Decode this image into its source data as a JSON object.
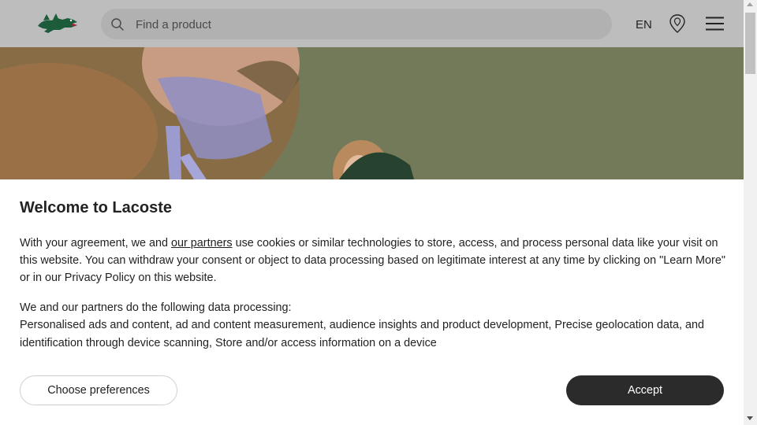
{
  "header": {
    "logo_icon": "crocodile-logo-icon",
    "search": {
      "placeholder": "Find a product",
      "icon": "search-icon"
    },
    "language": "EN",
    "store_locator_icon": "map-pin-icon",
    "menu_icon": "hamburger-menu-icon"
  },
  "consent": {
    "title": "Welcome to Lacoste",
    "body_before_link": "With your agreement, we and ",
    "partners_link": "our partners",
    "body_after_link": " use cookies or similar technologies to store, access, and process personal data like your visit on this website. You can withdraw your consent or object to data processing based on legitimate interest at any time by clicking on \"Learn More\" or in our Privacy Policy on this website.",
    "processing_heading": "We and our partners do the following data processing:",
    "processing_list": "Personalised ads and content, ad and content measurement, audience insights and product development, Precise geolocation data, and identification through device scanning, Store and/or access information on a device",
    "preferences_button": "Choose preferences",
    "accept_button": "Accept"
  },
  "colors": {
    "header_bg": "#bdbdbd",
    "logo_green": "#1d5c3a",
    "accept_bg": "#2b2b2b",
    "hero_backdrop": "#747b5a"
  }
}
